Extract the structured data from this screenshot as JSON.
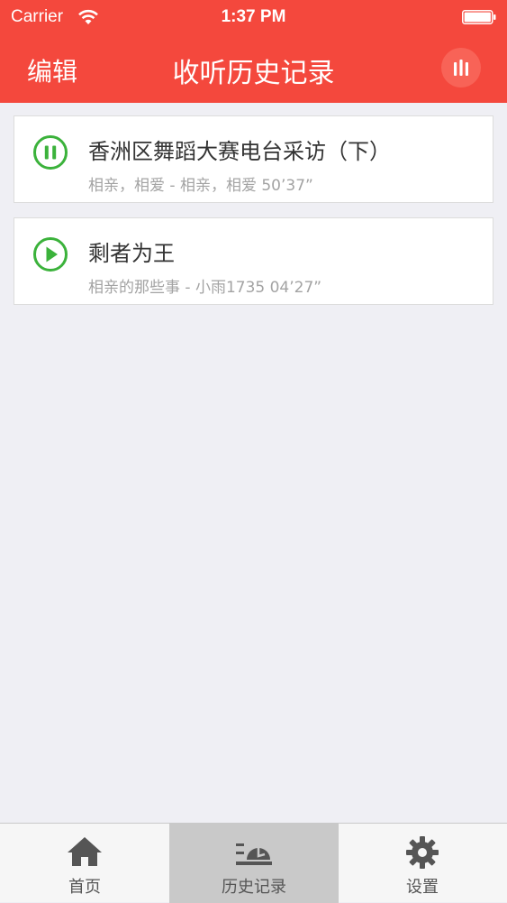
{
  "status_bar": {
    "carrier": "Carrier",
    "time": "1:37 PM"
  },
  "navbar": {
    "edit_label": "编辑",
    "title": "收听历史记录",
    "now_playing_icon": "equalizer-bars-icon"
  },
  "history": [
    {
      "title": "香洲区舞蹈大赛电台采访（下）",
      "subtitle": "相亲，相爱 - 相亲，相爱  50’37”",
      "state": "paused",
      "icon": "pause-circle-icon"
    },
    {
      "title": "剩者为王",
      "subtitle": "相亲的那些事 - 小雨1735  04’27”",
      "state": "stopped",
      "icon": "play-circle-icon"
    }
  ],
  "tabs": [
    {
      "label": "首页",
      "icon": "home-icon",
      "active": false
    },
    {
      "label": "历史记录",
      "icon": "history-icon",
      "active": true
    },
    {
      "label": "设置",
      "icon": "gear-icon",
      "active": false
    }
  ],
  "colors": {
    "accent": "#f4483d",
    "play_green": "#3bb23b",
    "tab_icon": "#555555"
  }
}
